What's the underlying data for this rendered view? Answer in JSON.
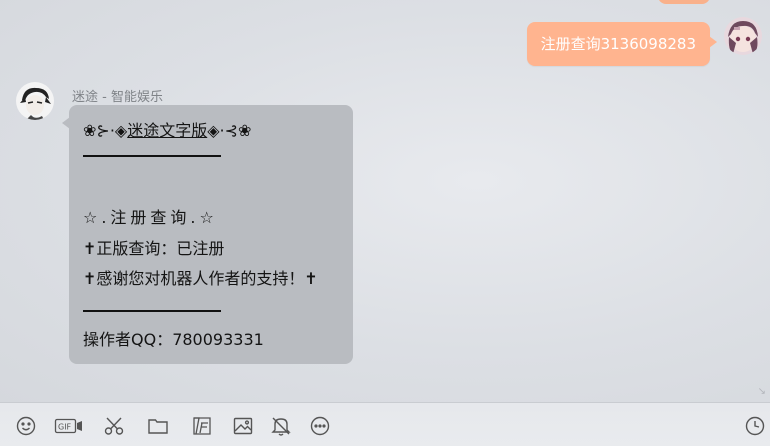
{
  "chat": {
    "sent_message": "注册查询3136098283",
    "sender_name": "迷途 - 智能娱乐",
    "reply": {
      "title_prefix": "❀⊱·◈",
      "title_link": "迷途文字版",
      "title_suffix": "◈·⊰❀",
      "section_title": "☆.注册查询.☆",
      "line_status": "✝正版查询：已注册",
      "line_thanks": "✝感谢您对机器人作者的支持！✝",
      "line_operator": "操作者QQ：780093331"
    }
  },
  "toolbar": {
    "icons": [
      "emoji-icon",
      "gif-icon",
      "scissors-icon",
      "folder-icon",
      "font-icon",
      "image-icon",
      "bell-icon",
      "more-icon",
      "history-icon"
    ]
  },
  "colors": {
    "sent_bubble": "#ffb48f",
    "received_bubble": "#b9bcc1",
    "background": "#dcdfe4"
  }
}
